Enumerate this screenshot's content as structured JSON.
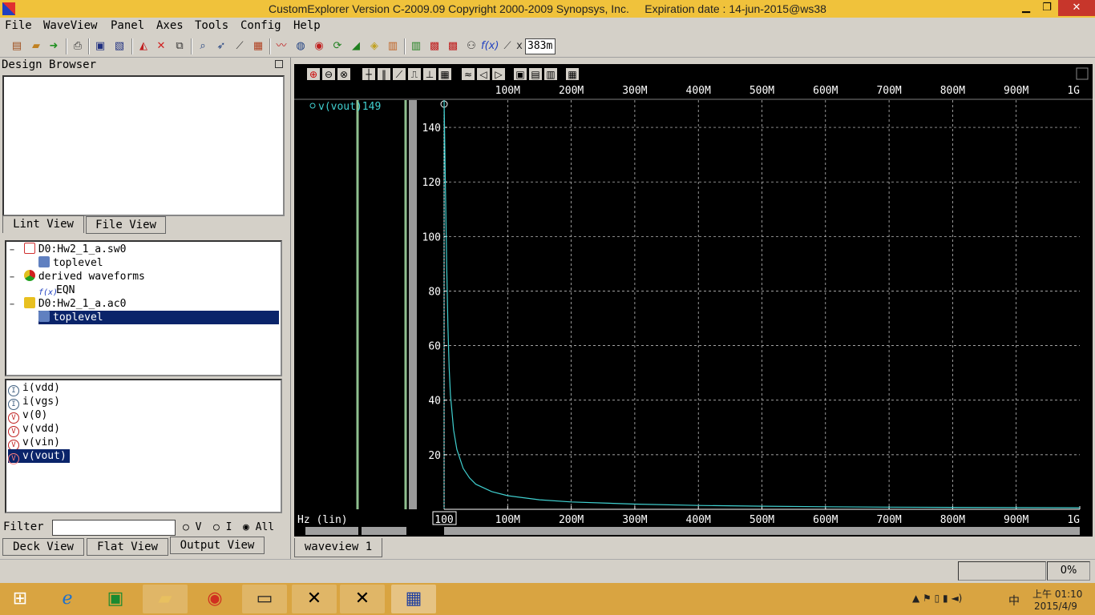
{
  "window": {
    "title": "CustomExplorer Version C-2009.09 Copyright 2000-2009 Synopsys, Inc.     Expiration date : 14-jun-2015@ws38",
    "minimize": "▁",
    "restore": "❐",
    "close": "✕"
  },
  "menu": [
    "File",
    "WaveView",
    "Panel",
    "Axes",
    "Tools",
    "Config",
    "Help"
  ],
  "toolbar": {
    "coord_label": "x",
    "coord_value": "383m",
    "icons": [
      "open-icon",
      "open-folder-icon",
      "go-arrow-icon",
      "print-icon",
      "save-icon",
      "save-as-icon",
      "waveform-icon",
      "delete-icon",
      "copy-icon",
      "zoom-icon",
      "cursor-icon",
      "probe-icon",
      "table-icon",
      "wave-plot-icon",
      "globe-icon",
      "target-icon",
      "refresh-icon",
      "stack-icon",
      "layers-icon",
      "bar-chart-icon",
      "bar-chart2-icon",
      "calc-icon",
      "calc2-icon",
      "eye-icon",
      "function-icon",
      "ruler-icon"
    ],
    "fx": "f(x)"
  },
  "left": {
    "design_browser_title": "Design Browser",
    "tabs_top": [
      "Lint View",
      "File View"
    ],
    "tree": [
      {
        "label": "D0:Hw2_1_a.sw0",
        "indent": 0,
        "icon": "sim-file-icon",
        "color": "#d03030",
        "expander": "−"
      },
      {
        "label": "toplevel",
        "indent": 1,
        "icon": "module-icon",
        "color": "#4060a0",
        "expander": ""
      },
      {
        "label": "derived waveforms",
        "indent": 0,
        "icon": "derived-icon",
        "color": "#30a030",
        "expander": "−"
      },
      {
        "label": "EQN",
        "indent": 1,
        "icon": "function-icon",
        "color": "#2040c0",
        "expander": ""
      },
      {
        "label": "D0:Hw2_1_a.ac0",
        "indent": 0,
        "icon": "sim-file-icon",
        "color": "#e0b020",
        "expander": "−"
      },
      {
        "label": "toplevel",
        "indent": 1,
        "icon": "module-icon",
        "color": "#4060a0",
        "expander": "",
        "selected": true
      }
    ],
    "signals": [
      {
        "label": "i(vdd)",
        "icon": "current-icon"
      },
      {
        "label": "i(vgs)",
        "icon": "current-icon"
      },
      {
        "label": "v(0)",
        "icon": "voltage-icon"
      },
      {
        "label": "v(vdd)",
        "icon": "voltage-icon"
      },
      {
        "label": "v(vin)",
        "icon": "voltage-icon"
      },
      {
        "label": "v(vout)",
        "icon": "voltage-icon",
        "selected": true
      }
    ],
    "filter_label": "Filter",
    "filter_value": "",
    "radio": [
      "V",
      "I",
      "All"
    ],
    "radio_selected": "All",
    "tabs_bottom": [
      "Deck View",
      "Flat View",
      "Output View"
    ],
    "active_bottom_tab": "Output View"
  },
  "wave_toolbar_icons": [
    "zoom-in-icon",
    "zoom-out-icon",
    "zoom-fit-icon",
    "cross-cursor-icon",
    "bars-icon",
    "diagonal-icon",
    "measure-icon",
    "marker-icon",
    "grid-icon",
    "wave-icon",
    "left-icon",
    "right-icon",
    "panel-icon",
    "panel2-icon",
    "panel3-icon",
    "panel4-icon"
  ],
  "chart_data": {
    "type": "line",
    "title": "",
    "xlabel": "Hz (lin)",
    "ylabel": "",
    "xlim": [
      100,
      1000000000
    ],
    "ylim": [
      0,
      150
    ],
    "x_ticks": [
      "100",
      "100M",
      "200M",
      "300M",
      "400M",
      "500M",
      "600M",
      "700M",
      "800M",
      "900M",
      "1G"
    ],
    "y_ticks": [
      "20",
      "40",
      "60",
      "80",
      "100",
      "120",
      "140"
    ],
    "grid": true,
    "series": [
      {
        "name": "v(vout)149",
        "color": "#40d0d0",
        "x": [
          100,
          2000000,
          4000000,
          6000000,
          8000000,
          10000000,
          15000000,
          20000000,
          30000000,
          40000000,
          50000000,
          75000000,
          100000000,
          150000000,
          200000000,
          300000000,
          400000000,
          500000000,
          600000000,
          700000000,
          800000000,
          900000000,
          1000000000
        ],
        "values": [
          150,
          120,
          90,
          67,
          52,
          42,
          29,
          22,
          15,
          11.5,
          9.2,
          6.5,
          5,
          3.5,
          2.7,
          1.9,
          1.4,
          1.15,
          0.95,
          0.8,
          0.7,
          0.62,
          0.55
        ]
      }
    ]
  },
  "wave_tab": "waveview 1",
  "status": {
    "progress": "0%"
  },
  "taskbar": {
    "apps": [
      "ie-icon",
      "store-icon",
      "explorer-icon",
      "chrome-icon",
      "terminal-icon",
      "x-icon",
      "x2-icon",
      "custom-explorer-icon"
    ],
    "time": "上午 01:10",
    "date": "2015/4/9",
    "ime": "中"
  }
}
